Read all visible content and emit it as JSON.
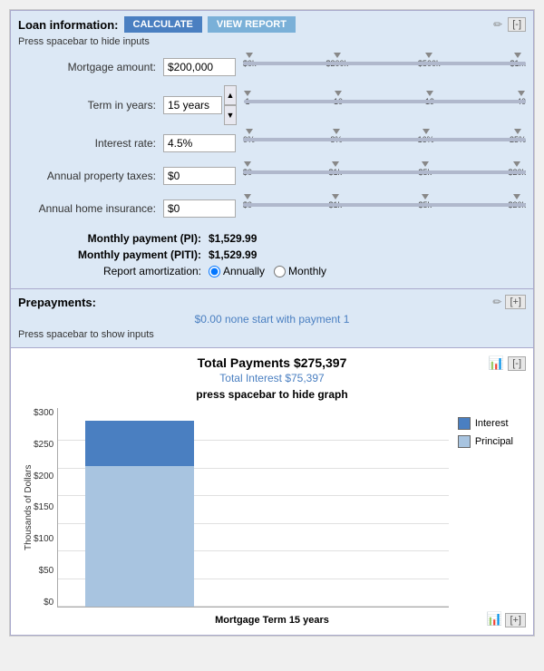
{
  "loan": {
    "title": "Loan information:",
    "btn_calculate": "CALCULATE",
    "btn_view_report": "VIEW REPORT",
    "press_hint": "Press spacebar to hide inputs",
    "mortgage_label": "Mortgage amount:",
    "mortgage_value": "$200,000",
    "term_label": "Term in years:",
    "term_value": "15 years",
    "rate_label": "Interest rate:",
    "rate_value": "4.5%",
    "taxes_label": "Annual property taxes:",
    "taxes_value": "$0",
    "insurance_label": "Annual home insurance:",
    "insurance_value": "$0",
    "monthly_pi_label": "Monthly payment (PI):",
    "monthly_pi_value": "$1,529.99",
    "monthly_piti_label": "Monthly payment (PITI):",
    "monthly_piti_value": "$1,529.99",
    "amort_label": "Report amortization:",
    "amort_annually": "Annually",
    "amort_monthly": "Monthly",
    "mortgage_ticks": [
      "$0k",
      "$200k",
      "$500k",
      "$1m"
    ],
    "term_ticks": [
      "1",
      "10",
      "19",
      "40"
    ],
    "rate_ticks": [
      "0%",
      "8%",
      "16%",
      "25%"
    ],
    "taxes_ticks": [
      "$0",
      "$1k",
      "$5k",
      "$20k"
    ],
    "insurance_ticks": [
      "$0",
      "$1k",
      "$5k",
      "$20k"
    ],
    "edit_icon": "✏",
    "collapse": "[-]"
  },
  "prepayments": {
    "title": "Prepayments:",
    "value": "$0.00 none start with payment 1",
    "show_hint": "Press spacebar to show inputs",
    "edit_icon": "✏",
    "expand": "[+]"
  },
  "chart": {
    "total_payments_label": "Total Payments $275,397",
    "total_interest_label": "Total Interest $75,397",
    "hint": "press spacebar to hide graph",
    "y_axis_title": "Thousands of Dollars",
    "y_ticks": [
      "$300",
      "$250",
      "$200",
      "$150",
      "$100",
      "$50",
      "$0"
    ],
    "x_label": "Mortgage Term 15 years",
    "legend": [
      {
        "label": "Interest",
        "color": "#4a7fc1"
      },
      {
        "label": "Principal",
        "color": "#a8c4e0"
      }
    ],
    "bar_interest_height": 50,
    "bar_principal_height": 155,
    "bar_icon": "📊",
    "expand": "[+]",
    "collapse": "[-]"
  }
}
